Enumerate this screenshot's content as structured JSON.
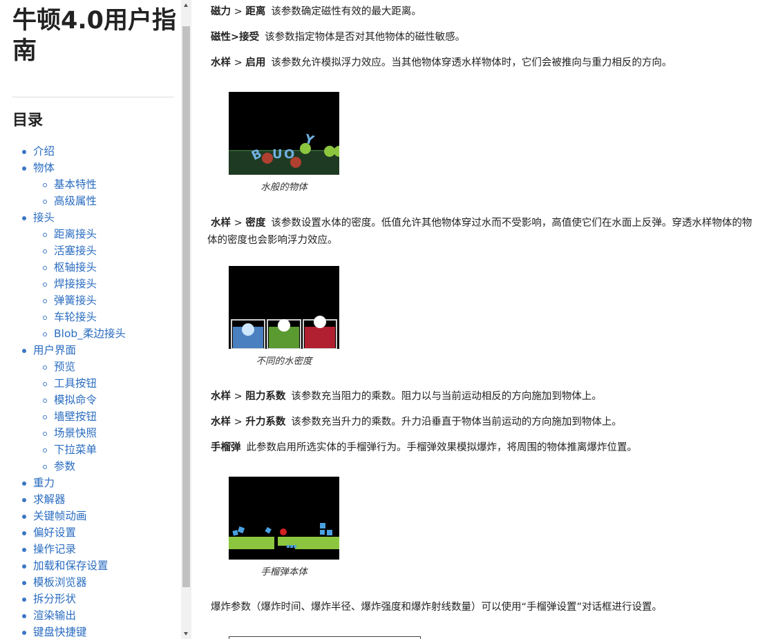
{
  "sidebar": {
    "title": "牛顿4.0用户指南",
    "toc_heading": "目录",
    "items": [
      {
        "label": "介绍",
        "level": 1
      },
      {
        "label": "物体",
        "level": 1
      },
      {
        "label": "基本特性",
        "level": 2
      },
      {
        "label": "高级属性",
        "level": 2
      },
      {
        "label": "接头",
        "level": 1
      },
      {
        "label": "距离接头",
        "level": 2
      },
      {
        "label": "活塞接头",
        "level": 2
      },
      {
        "label": "枢轴接头",
        "level": 2
      },
      {
        "label": "焊接接头",
        "level": 2
      },
      {
        "label": "弹簧接头",
        "level": 2
      },
      {
        "label": "车轮接头",
        "level": 2
      },
      {
        "label": "Blob_柔边接头",
        "level": 2
      },
      {
        "label": "用户界面",
        "level": 1
      },
      {
        "label": "预览",
        "level": 2
      },
      {
        "label": "工具按钮",
        "level": 2
      },
      {
        "label": "模拟命令",
        "level": 2
      },
      {
        "label": "墙壁按钮",
        "level": 2
      },
      {
        "label": "场景快照",
        "level": 2
      },
      {
        "label": "下拉菜单",
        "level": 2
      },
      {
        "label": "参数",
        "level": 2
      },
      {
        "label": "重力",
        "level": 1
      },
      {
        "label": "求解器",
        "level": 1
      },
      {
        "label": "关键帧动画",
        "level": 1
      },
      {
        "label": "偏好设置",
        "level": 1
      },
      {
        "label": "操作记录",
        "level": 1
      },
      {
        "label": "加载和保存设置",
        "level": 1
      },
      {
        "label": "模板浏览器",
        "level": 1
      },
      {
        "label": "拆分形状",
        "level": 1
      },
      {
        "label": "渲染输出",
        "level": 1
      },
      {
        "label": "键盘快捷键",
        "level": 1
      }
    ]
  },
  "main": {
    "p_magnet_distance": {
      "term1": "磁力",
      "sep": ">",
      "term2": "距离",
      "desc": "该参数确定磁性有效的最大距离。"
    },
    "p_magnet_receive": {
      "term": "磁性>接受",
      "desc": "该参数指定物体是否对其他物体的磁性敏感。"
    },
    "p_water_enable": {
      "term1": "水样",
      "sep": ">",
      "term2": "启用",
      "desc": "该参数允许模拟浮力效应。当其他物体穿透水样物体时，它们会被推向与重力相反的方向。"
    },
    "fig1_caption": "水般的物体",
    "fig1_text": "BUOY",
    "p_water_density": {
      "term1": "水样",
      "sep": ">",
      "term2": "密度",
      "desc": "该参数设置水体的密度。低值允许其他物体穿过水而不受影响，高值使它们在水面上反弹。穿透水样物体的物体的密度也会影响浮力效应。"
    },
    "fig2_caption": "不同的水密度",
    "p_drag": {
      "term1": "水样",
      "sep": ">",
      "term2": "阻力系数",
      "desc": "该参数充当阻力的乘数。阻力以与当前运动相反的方向施加到物体上。"
    },
    "p_lift": {
      "term1": "水样",
      "sep": ">",
      "term2": "升力系数",
      "desc": "该参数充当升力的乘数。升力沿垂直于物体当前运动的方向施加到物体上。"
    },
    "p_grenade": {
      "term": "手榴弹",
      "desc": "此参数启用所选实体的手榴弹行为。手榴弹效果模拟爆炸，将周围的物体推离爆炸位置。"
    },
    "fig3_caption": "手榴弹本体",
    "p_explosion": "爆炸参数（爆炸时间、爆炸半径、爆炸强度和爆炸射线数量）可以使用“手榴弹设置”对话框进行设置。"
  },
  "colors": {
    "link": "#2a6cc0",
    "water_blue": "#4a80c0",
    "water_green": "#5a9a30",
    "water_red": "#b02030",
    "grass_green": "#8cc63f"
  }
}
